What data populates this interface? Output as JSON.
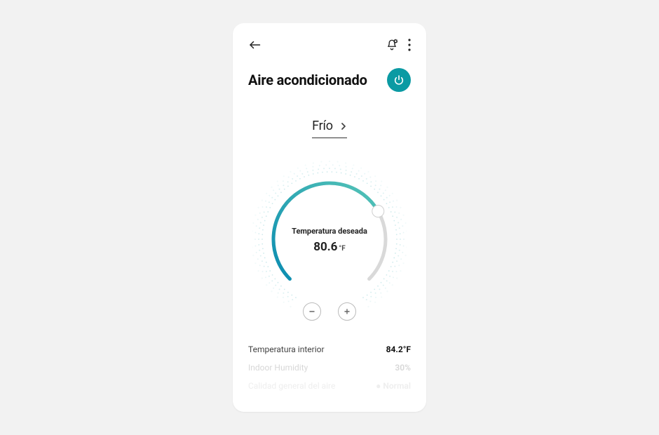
{
  "header": {
    "title": "Aire acondicionado"
  },
  "mode": {
    "label": "Frío"
  },
  "dial": {
    "desired_label": "Temperatura deseada",
    "desired_value": "80.6",
    "desired_unit": "°F"
  },
  "stats": {
    "indoor_temp": {
      "label": "Temperatura interior",
      "value": "84.2°F"
    },
    "indoor_humidity": {
      "label": "Indoor Humidity",
      "value": "30%"
    },
    "air_quality": {
      "label": "Calidad general del aire",
      "value": "● Normal"
    }
  },
  "colors": {
    "accent": "#0b9aa3",
    "gradient_start": "#0a8cb1",
    "gradient_end": "#56c5b7",
    "track": "#d9d9d9"
  }
}
